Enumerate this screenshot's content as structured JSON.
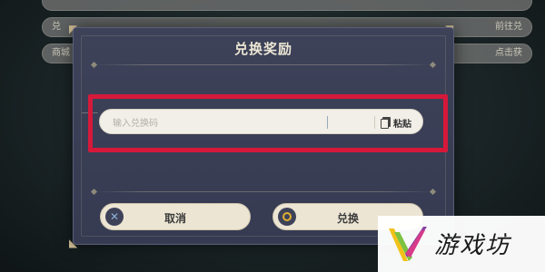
{
  "background": {
    "rows": [
      {
        "left": "",
        "right": ""
      },
      {
        "left": "兑",
        "right": "前往兑"
      },
      {
        "left": "商城",
        "right": "点击获"
      }
    ]
  },
  "dialog": {
    "title": "兑换奖励",
    "input": {
      "value": "",
      "placeholder": "输入兑换码"
    },
    "paste_label": "粘贴",
    "cancel_label": "取消",
    "confirm_label": "兑换"
  },
  "watermark": {
    "text": "游戏坊"
  },
  "colors": {
    "dialog_bg": "#3d4259",
    "highlight": "#d6193a",
    "button_bg": "#ece5d3",
    "confirm_icon": "#e0b030",
    "cancel_icon": "#8fb0d6"
  },
  "icons": {
    "paste": "clipboard-icon",
    "cancel": "x-icon",
    "confirm": "circle-icon",
    "corner": "corner-ornament-icon"
  }
}
